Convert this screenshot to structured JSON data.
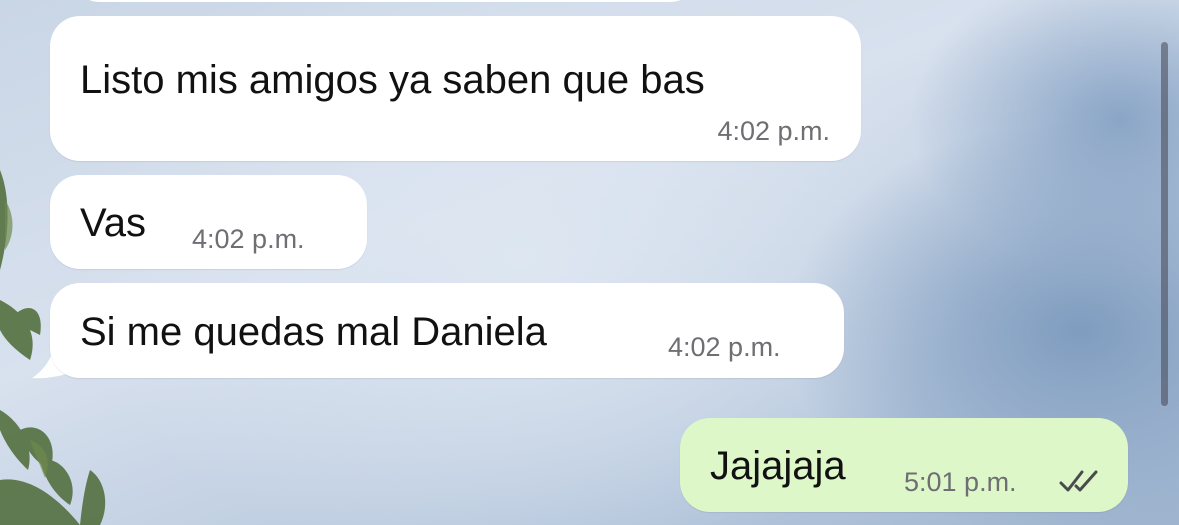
{
  "messages": [
    {
      "direction": "incoming",
      "text": "Listo mis amigos ya saben que bas",
      "time": "4:02 p.m."
    },
    {
      "direction": "incoming",
      "text": "Vas",
      "time": "4:02 p.m."
    },
    {
      "direction": "incoming",
      "text": "Si me quedas mal Daniela",
      "time": "4:02 p.m."
    },
    {
      "direction": "outgoing",
      "text": "Jajajaja",
      "time": "5:01 p.m.",
      "status_icon": "double-check-icon"
    }
  ],
  "colors": {
    "incoming_bubble": "#ffffff",
    "outgoing_bubble": "#ddf7c9",
    "timestamp": "#6e6e73",
    "message_text": "#111111"
  }
}
